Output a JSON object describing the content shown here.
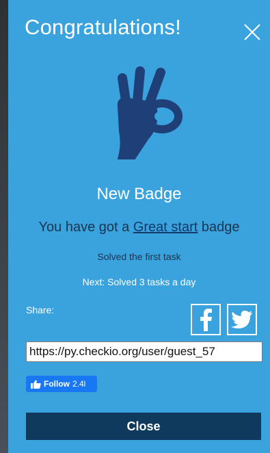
{
  "modal": {
    "title": "Congratulations!",
    "badge_title": "New Badge",
    "got_prefix": "You have got a ",
    "badge_name": "Great start",
    "got_suffix": " badge",
    "description": "Solved the first task",
    "next": "Next: Solved 3 tasks a day",
    "share_label": "Share:",
    "share_url": "https://py.checkio.org/user/guest_57",
    "follow_label": "Follow",
    "follow_count": "2.4l",
    "close_label": "Close"
  },
  "icons": {
    "close": "close-icon",
    "badge": "ok-hand-icon",
    "facebook": "facebook-icon",
    "twitter": "twitter-icon",
    "like": "thumbs-up-icon"
  },
  "colors": {
    "modal_bg": "#3aa2dd",
    "hand": "#1f3f78",
    "close_button": "#0f3a5e",
    "facebook_follow": "#1877f2"
  }
}
